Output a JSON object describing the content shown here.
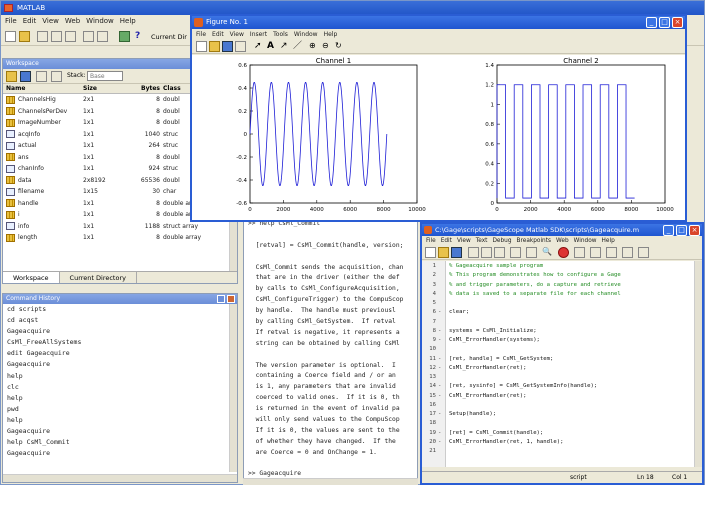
{
  "matlab": {
    "title": "MATLAB",
    "menu": [
      "File",
      "Edit",
      "View",
      "Web",
      "Window",
      "Help"
    ],
    "current_dir_label": "Current Dir"
  },
  "workspace": {
    "title": "Workspace",
    "stack_label": "Stack:",
    "stack_value": "Base",
    "columns": [
      "Name",
      "Size",
      "Bytes",
      "Class"
    ],
    "rows": [
      {
        "name": "ChannelsHig",
        "size": "2x1",
        "bytes": "8",
        "cls": "doubl",
        "icon": "matrix"
      },
      {
        "name": "ChannelsPerDev",
        "size": "1x1",
        "bytes": "8",
        "cls": "doubl",
        "icon": "matrix"
      },
      {
        "name": "ImageNumber",
        "size": "1x1",
        "bytes": "8",
        "cls": "doubl",
        "icon": "matrix"
      },
      {
        "name": "acqInfo",
        "size": "1x1",
        "bytes": "1040",
        "cls": "struc",
        "icon": "struct"
      },
      {
        "name": "actual",
        "size": "1x1",
        "bytes": "264",
        "cls": "struc",
        "icon": "struct"
      },
      {
        "name": "ans",
        "size": "1x1",
        "bytes": "8",
        "cls": "doubl",
        "icon": "matrix"
      },
      {
        "name": "chanInfo",
        "size": "1x1",
        "bytes": "924",
        "cls": "struc",
        "icon": "struct"
      },
      {
        "name": "data",
        "size": "2x8192",
        "bytes": "65536",
        "cls": "doubl",
        "icon": "matrix"
      },
      {
        "name": "filename",
        "size": "1x15",
        "bytes": "30",
        "cls": "char",
        "icon": "struct"
      },
      {
        "name": "handle",
        "size": "1x1",
        "bytes": "8",
        "cls": "double array",
        "icon": "matrix"
      },
      {
        "name": "i",
        "size": "1x1",
        "bytes": "8",
        "cls": "double array",
        "icon": "matrix"
      },
      {
        "name": "info",
        "size": "1x1",
        "bytes": "1188",
        "cls": "struct array",
        "icon": "struct"
      },
      {
        "name": "length",
        "size": "1x1",
        "bytes": "8",
        "cls": "double array",
        "icon": "matrix"
      }
    ],
    "tabs": [
      "Workspace",
      "Current Directory"
    ]
  },
  "history": {
    "title": "Command History",
    "items": [
      "cd scripts",
      "cd acqst",
      "Gageacquire",
      "CsMl_FreeAllSystems",
      "edit Gageacquire",
      "Gageacquire",
      "help",
      "clc",
      "help",
      "pwd",
      "help",
      "Gageacquire",
      "help CsMl_Commit",
      "Gageacquire"
    ]
  },
  "command_window": {
    "lines": [
      ">> help CsMl_Commit",
      "",
      "  [retval] = CsMl_Commit(handle, version;",
      "",
      "  CsMl_Commit sends the acquisition, chan",
      "  that are in the driver (either the def",
      "  by calls to CsMl_ConfigureAcquisition,",
      "  CsMl_ConfigureTrigger) to the CompuScop",
      "  by handle.  The handle must previousl",
      "  by calling CsMl_GetSystem.  If retval",
      "  If retval is negative, it represents a",
      "  string can be obtained by calling CsMl",
      "",
      "  The version parameter is optional.  I",
      "  containing a Coerce field and / or an",
      "  is 1, any parameters that are invalid",
      "  coerced to valid ones.  If it is 0, th",
      "  is returned in the event of invalid pa",
      "  will only send values to the CompuScop",
      "  If it is 0, the values are sent to the",
      "  of whether they have changed.  If the",
      "  are Coerce = 0 and OnChange = 1.",
      "",
      ">> Gageacquire",
      ""
    ]
  },
  "figure": {
    "title": "Figure No. 1",
    "menu": [
      "File",
      "Edit",
      "View",
      "Insert",
      "Tools",
      "Window",
      "Help"
    ]
  },
  "chart_data": [
    {
      "type": "line",
      "title": "Channel 1",
      "x_ticks": [
        "0",
        "2000",
        "4000",
        "6000",
        "8000",
        "10000"
      ],
      "y_ticks": [
        "-0.6",
        "-0.4",
        "-0.2",
        "0",
        "0.2",
        "0.4",
        "0.6"
      ],
      "xlim": [
        0,
        10000
      ],
      "ylim": [
        -0.6,
        0.6
      ],
      "series": [
        {
          "shape": "sine",
          "amplitude": 0.45,
          "cycles": 8,
          "x_end": 8192
        }
      ],
      "color": "#1f1fd6"
    },
    {
      "type": "line",
      "title": "Channel 2",
      "x_ticks": [
        "0",
        "2000",
        "4000",
        "6000",
        "8000",
        "10000"
      ],
      "y_ticks": [
        "0",
        "0.2",
        "0.4",
        "0.6",
        "0.8",
        "1",
        "1.2",
        "1.4"
      ],
      "xlim": [
        0,
        10000
      ],
      "ylim": [
        0,
        1.4
      ],
      "series": [
        {
          "shape": "square",
          "low": 0.05,
          "high": 1.2,
          "cycles": 8,
          "x_end": 8192
        }
      ],
      "color": "#1f1fd6"
    }
  ],
  "editor": {
    "title": "C:\\Gage\\scripts\\GageScope Matlab SDK\\scripts\\Gageacquire.m",
    "menu": [
      "File",
      "Edit",
      "View",
      "Text",
      "Debug",
      "Breakpoints",
      "Web",
      "Window",
      "Help"
    ],
    "lines": [
      {
        "n": "1",
        "dash": "",
        "code": "% Gageacquire sample program",
        "comment": true
      },
      {
        "n": "2",
        "dash": "",
        "code": "% This program demonstrates how to configure a Gage",
        "comment": true
      },
      {
        "n": "3",
        "dash": "",
        "code": "% and trigger parameters, do a capture and retrieve",
        "comment": true
      },
      {
        "n": "4",
        "dash": "",
        "code": "% data is saved to a separate file for each channel",
        "comment": true
      },
      {
        "n": "5",
        "dash": "",
        "code": "",
        "comment": false
      },
      {
        "n": "6",
        "dash": "-",
        "code": "clear;",
        "comment": false
      },
      {
        "n": "7",
        "dash": "",
        "code": "",
        "comment": false
      },
      {
        "n": "8",
        "dash": "-",
        "code": "systems = CsMl_Initialize;",
        "comment": false
      },
      {
        "n": "9",
        "dash": "-",
        "code": "CsMl_ErrorHandler(systems);",
        "comment": false
      },
      {
        "n": "10",
        "dash": "",
        "code": "",
        "comment": false
      },
      {
        "n": "11",
        "dash": "-",
        "code": "[ret, handle] = CsMl_GetSystem;",
        "comment": false
      },
      {
        "n": "12",
        "dash": "-",
        "code": "CsMl_ErrorHandler(ret);",
        "comment": false
      },
      {
        "n": "13",
        "dash": "",
        "code": "",
        "comment": false
      },
      {
        "n": "14",
        "dash": "-",
        "code": "[ret, sysinfo] = CsMl_GetSystemInfo(handle);",
        "comment": false
      },
      {
        "n": "15",
        "dash": "-",
        "code": "CsMl_ErrorHandler(ret);",
        "comment": false
      },
      {
        "n": "16",
        "dash": "",
        "code": "",
        "comment": false
      },
      {
        "n": "17",
        "dash": "-",
        "code": "Setup(handle);",
        "comment": false
      },
      {
        "n": "18",
        "dash": "",
        "code": "",
        "comment": false
      },
      {
        "n": "19",
        "dash": "-",
        "code": "[ret] = CsMl_Commit(handle);",
        "comment": false
      },
      {
        "n": "20",
        "dash": "-",
        "code": "CsMl_ErrorHandler(ret, 1, handle);",
        "comment": false
      },
      {
        "n": "21",
        "dash": "",
        "code": "",
        "comment": false
      }
    ],
    "status_mode": "script",
    "status_ln": "Ln 18",
    "status_col": "Col 1"
  },
  "colors": {
    "titlebar": "#2155c8",
    "comment": "#228b22",
    "plot_line": "#1f1fd6"
  }
}
